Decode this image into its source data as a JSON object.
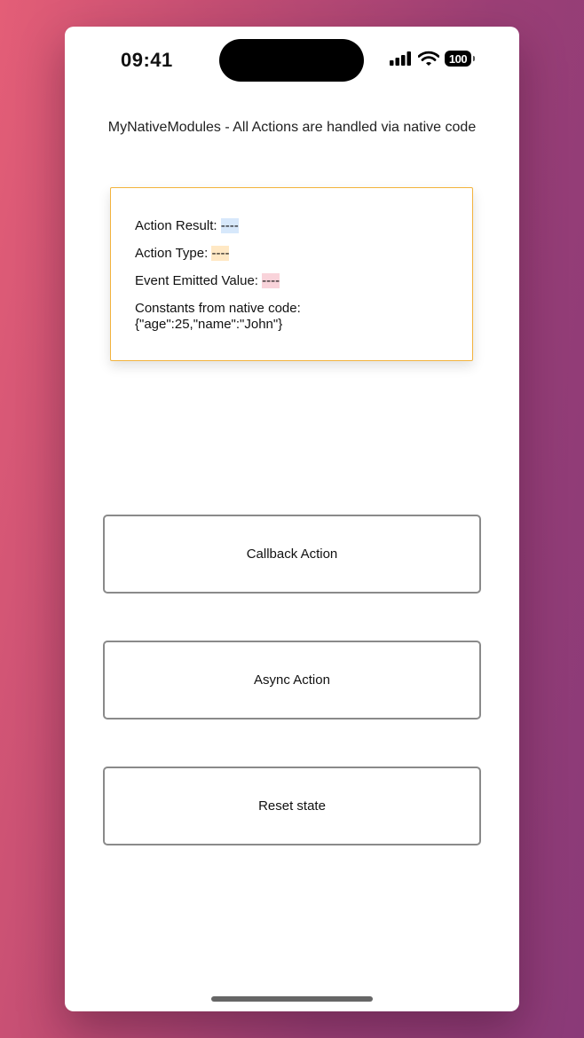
{
  "status_bar": {
    "time": "09:41",
    "battery": "100",
    "signal_icon": "cellular-signal-icon",
    "wifi_icon": "wifi-icon",
    "battery_icon": "battery-icon"
  },
  "header": {
    "title": "MyNativeModules - All Actions are handled via native code"
  },
  "info_card": {
    "action_result_label": "Action Result:",
    "action_result_value": "----",
    "action_type_label": "Action Type:",
    "action_type_value": "----",
    "event_value_label": "Event Emitted Value:",
    "event_value_value": "----",
    "constants_label": "Constants from native code:",
    "constants_value": "{\"age\":25,\"name\":\"John\"}"
  },
  "buttons": {
    "callback_label": "Callback Action",
    "async_label": "Async Action",
    "reset_label": "Reset state"
  },
  "colors": {
    "card_border": "#f3b33d",
    "result_highlight": "#d7e8fb",
    "type_highlight": "#ffe8c4",
    "event_highlight": "#f9d3da",
    "button_border": "#8a8a8a"
  }
}
